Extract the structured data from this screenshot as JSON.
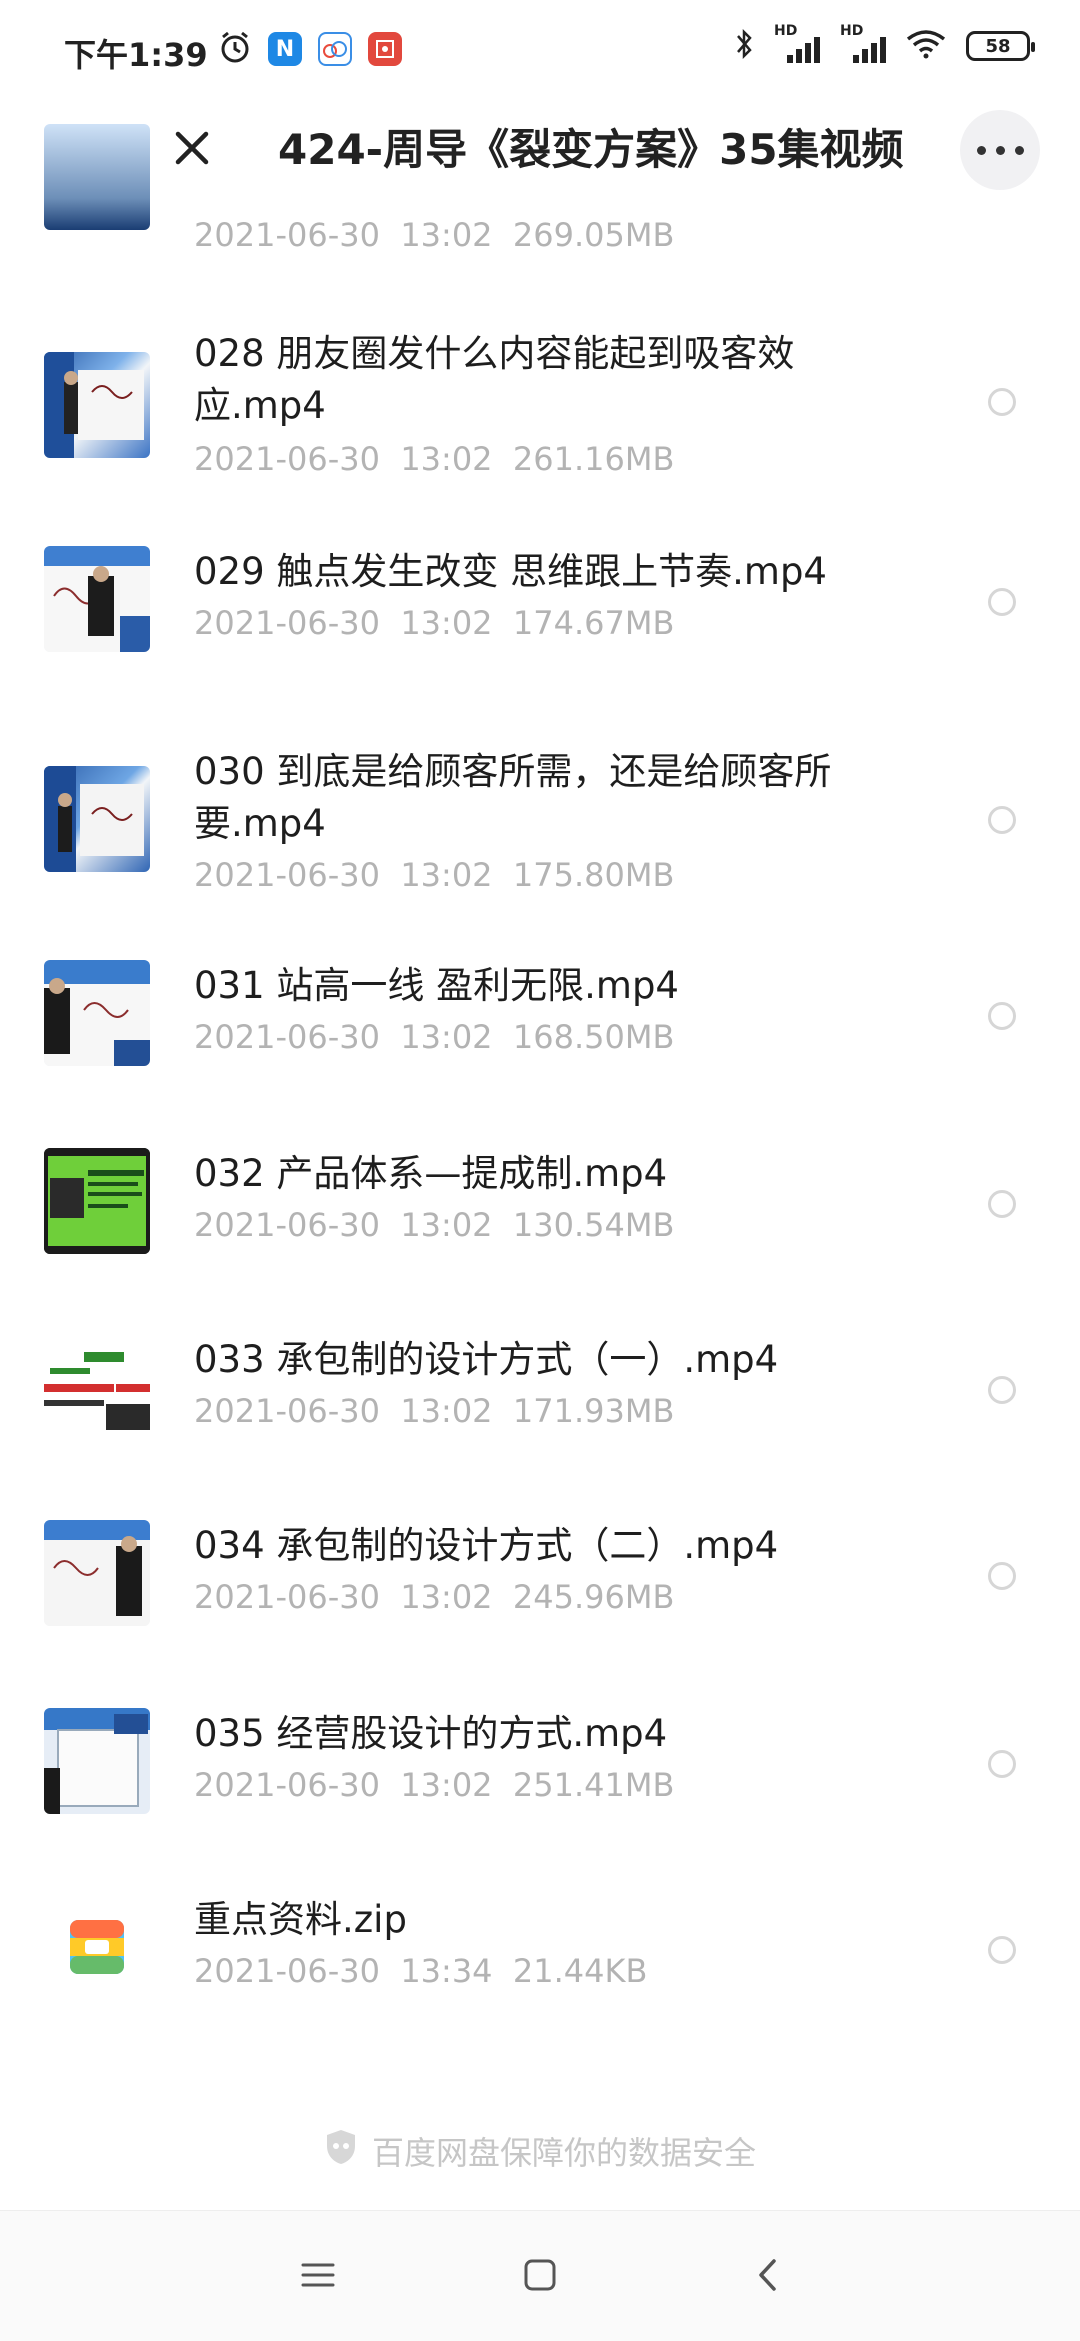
{
  "status_bar": {
    "time": "下午1:39",
    "battery": "58",
    "hd1": "HD",
    "hd2": "HD"
  },
  "header": {
    "title": "424-周导《裂变方案》35集视频"
  },
  "files": [
    {
      "name": "",
      "date": "2021-06-30",
      "time": "13:02",
      "size": "269.05MB",
      "type": "video"
    },
    {
      "name": "028 朋友圈发什么内容能起到吸客效应.mp4",
      "date": "2021-06-30",
      "time": "13:02",
      "size": "261.16MB",
      "type": "video"
    },
    {
      "name": "029 触点发生改变 思维跟上节奏.mp4",
      "date": "2021-06-30",
      "time": "13:02",
      "size": "174.67MB",
      "type": "video"
    },
    {
      "name": "030 到底是给顾客所需，还是给顾客所要.mp4",
      "date": "2021-06-30",
      "time": "13:02",
      "size": "175.80MB",
      "type": "video"
    },
    {
      "name": "031 站高一线 盈利无限.mp4",
      "date": "2021-06-30",
      "time": "13:02",
      "size": "168.50MB",
      "type": "video"
    },
    {
      "name": "032 产品体系—提成制.mp4",
      "date": "2021-06-30",
      "time": "13:02",
      "size": "130.54MB",
      "type": "video"
    },
    {
      "name": "033 承包制的设计方式（一）.mp4",
      "date": "2021-06-30",
      "time": "13:02",
      "size": "171.93MB",
      "type": "video"
    },
    {
      "name": "034 承包制的设计方式（二）.mp4",
      "date": "2021-06-30",
      "time": "13:02",
      "size": "245.96MB",
      "type": "video"
    },
    {
      "name": "035 经营股设计的方式.mp4",
      "date": "2021-06-30",
      "time": "13:02",
      "size": "251.41MB",
      "type": "video"
    },
    {
      "name": "重点资料.zip",
      "date": "2021-06-30",
      "time": "13:34",
      "size": "21.44KB",
      "type": "zip"
    }
  ],
  "footer": {
    "security_text": "百度网盘保障你的数据安全"
  },
  "colors": {
    "accent": "#2f6fd6",
    "meta_gray": "#b3b3b3"
  }
}
